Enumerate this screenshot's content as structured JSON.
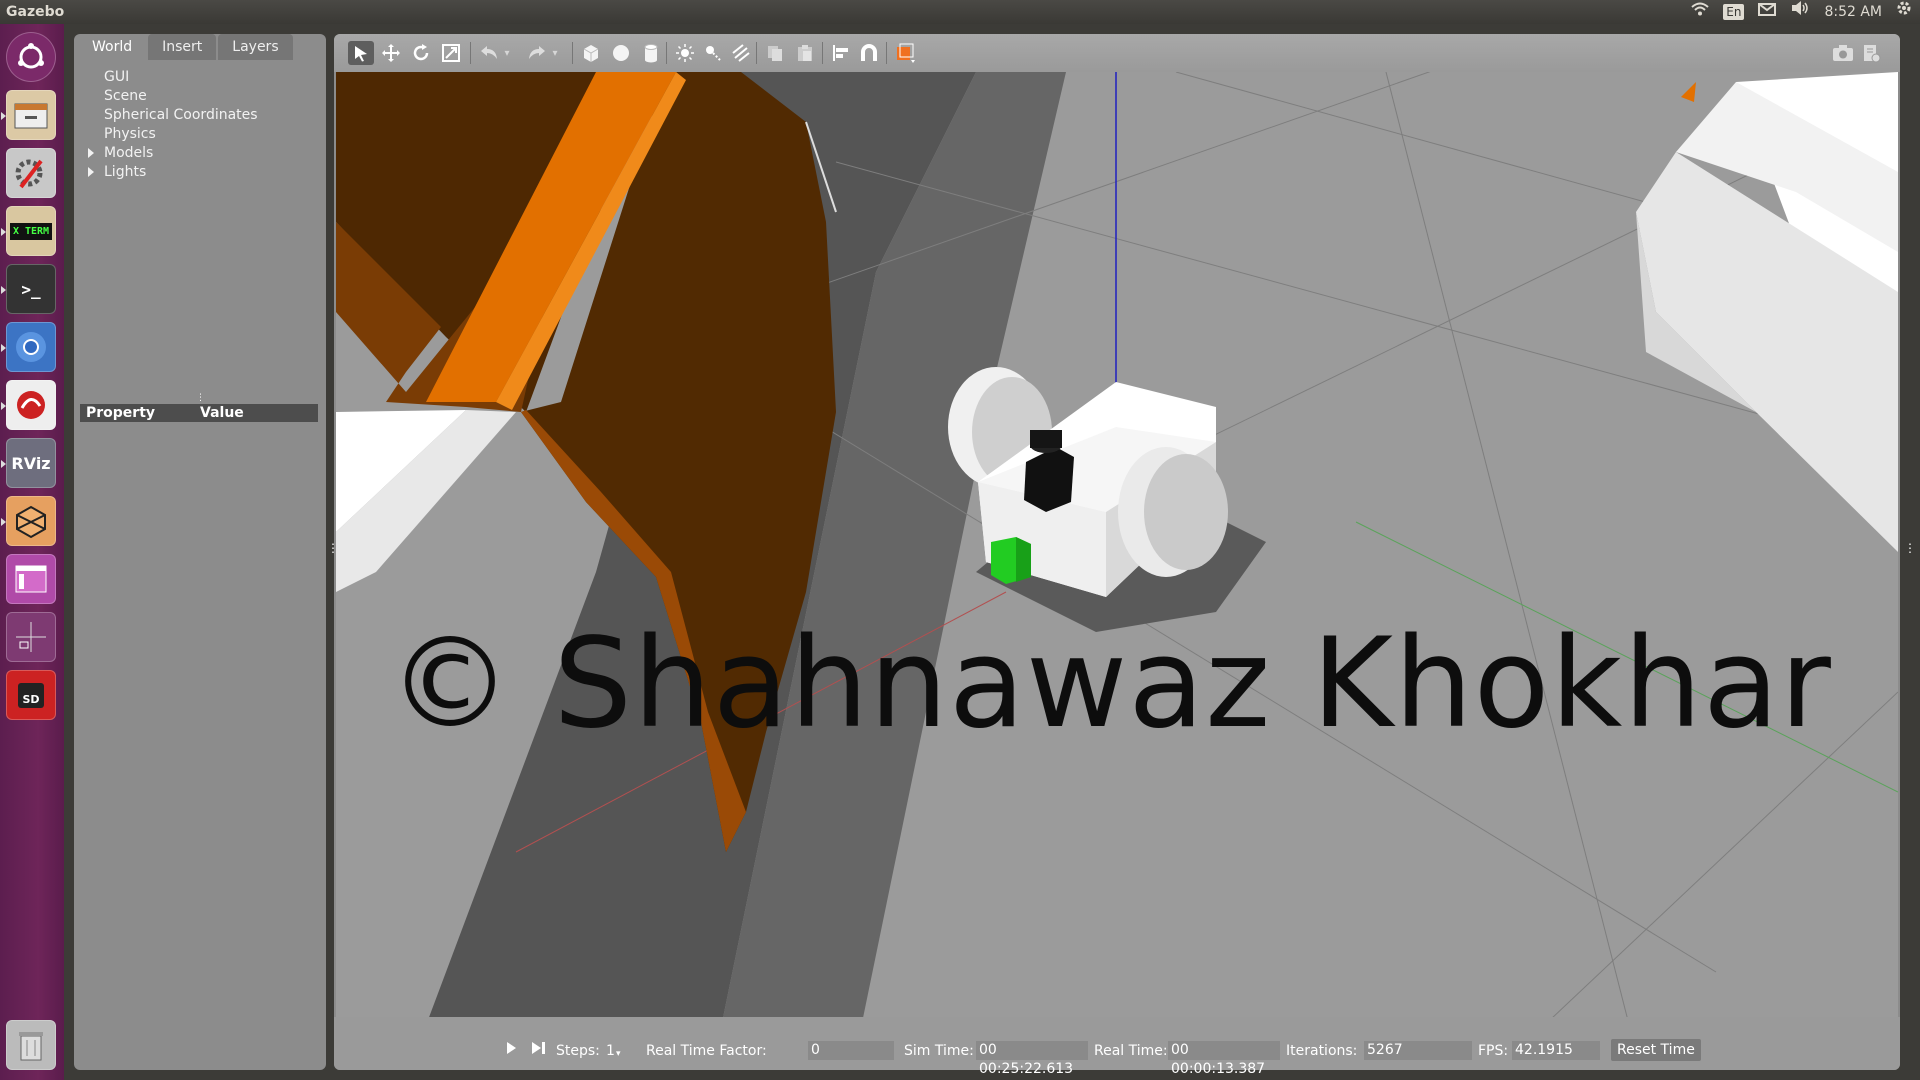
{
  "topbar": {
    "app_title": "Gazebo",
    "keyboard_layout": "En",
    "clock": "8:52 AM",
    "icons": [
      "wifi-icon",
      "keyboard-layout-badge",
      "mail-icon",
      "volume-icon",
      "settings-gear-icon"
    ]
  },
  "launcher": {
    "items": [
      {
        "name": "ubuntu-dash",
        "label": ""
      },
      {
        "name": "files",
        "label": ""
      },
      {
        "name": "system-settings",
        "label": ""
      },
      {
        "name": "xterm",
        "label": "X TERM"
      },
      {
        "name": "terminal",
        "label": ">_"
      },
      {
        "name": "chromium",
        "label": ""
      },
      {
        "name": "text-editor",
        "label": ""
      },
      {
        "name": "rviz",
        "label": "RViz"
      },
      {
        "name": "gazebo",
        "label": ""
      },
      {
        "name": "window-app",
        "label": ""
      },
      {
        "name": "workspace-switcher",
        "label": ""
      },
      {
        "name": "sd-card",
        "label": "SD"
      },
      {
        "name": "trash",
        "label": ""
      }
    ]
  },
  "left_panel": {
    "tabs": [
      "World",
      "Insert",
      "Layers"
    ],
    "active_tab": "World",
    "tree": [
      {
        "label": "GUI",
        "expandable": false
      },
      {
        "label": "Scene",
        "expandable": false
      },
      {
        "label": "Spherical Coordinates",
        "expandable": false
      },
      {
        "label": "Physics",
        "expandable": false
      },
      {
        "label": "Models",
        "expandable": true
      },
      {
        "label": "Lights",
        "expandable": true
      }
    ],
    "property_header": {
      "property": "Property",
      "value": "Value"
    }
  },
  "toolbar": {
    "tools": [
      "select-arrow-icon",
      "translate-icon",
      "rotate-icon",
      "scale-icon",
      "undo-icon",
      "redo-icon",
      "box-shape-icon",
      "sphere-shape-icon",
      "cylinder-shape-icon",
      "point-light-icon",
      "spot-light-icon",
      "directional-light-icon",
      "copy-icon",
      "paste-icon",
      "align-icon",
      "snap-magnet-icon",
      "view-angle-icon",
      "screenshot-camera-icon",
      "record-log-icon"
    ],
    "active_tool": "select-arrow-icon"
  },
  "viewport": {
    "watermark": "© Shahnawaz Khokhar",
    "colors": {
      "ground": "#9a9a9a",
      "shadow_strip": "#505050",
      "orange_wall_dark": "#4e2802",
      "orange_wall_edge": "#e27000",
      "robot_body": "#ffffff",
      "lidar": "#111111",
      "front_marker": "#22cc22"
    }
  },
  "statusbar": {
    "steps_label": "Steps:",
    "steps_value": "1",
    "rtf_label": "Real Time Factor:",
    "rtf_value": "0",
    "sim_time_label": "Sim Time:",
    "sim_time_value": "00 00:25:22.613",
    "real_time_label": "Real Time:",
    "real_time_value": "00 00:00:13.387",
    "iterations_label": "Iterations:",
    "iterations_value": "5267",
    "fps_label": "FPS:",
    "fps_value": "42.1915",
    "reset_label": "Reset Time"
  }
}
